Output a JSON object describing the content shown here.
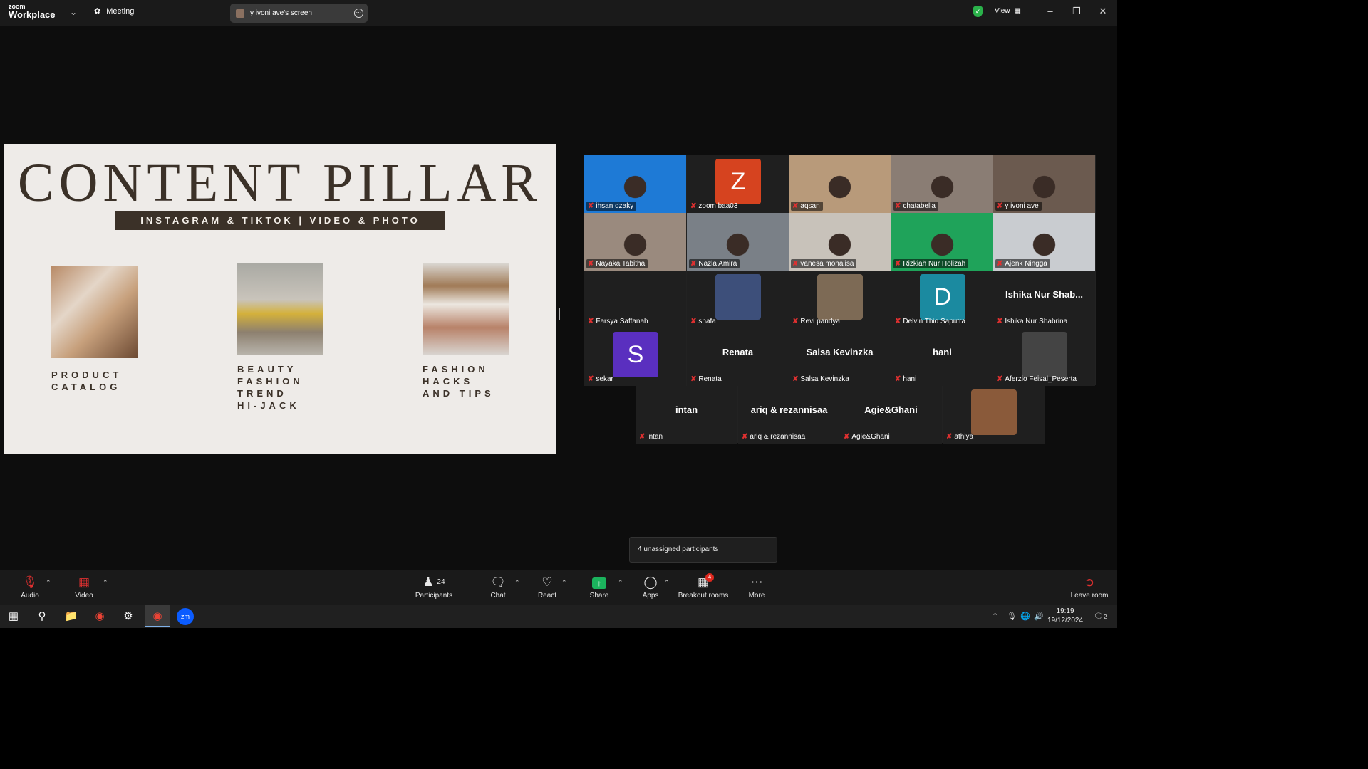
{
  "app": {
    "brand_top": "zoom",
    "brand_name": "Workplace",
    "meeting_label": "Meeting"
  },
  "screen_share": {
    "label": "y ivoni ave's screen"
  },
  "topbar": {
    "view_label": "View"
  },
  "slide": {
    "title": "CONTENT PILLAR",
    "subtitle": "INSTAGRAM & TIKTOK | VIDEO & PHOTO",
    "pillars": [
      {
        "caption": "PRODUCT\nCATALOG"
      },
      {
        "caption": "BEAUTY\nFASHION\nTREND\nHI-JACK"
      },
      {
        "caption": "FASHION\nHACKS\nAND TIPS"
      }
    ]
  },
  "participants": [
    {
      "name": "ihsan dzaky",
      "kind": "video",
      "bg": "#1e7ad6"
    },
    {
      "name": "zoom baa03",
      "kind": "avatar",
      "letter": "Z",
      "bg": "#d6431f"
    },
    {
      "name": "aqsan",
      "kind": "video",
      "bg": "#b89a7a"
    },
    {
      "name": "chatabella",
      "kind": "video",
      "bg": "#8a7d74"
    },
    {
      "name": "y ivoni ave",
      "kind": "video",
      "bg": "#6b5a4f"
    },
    {
      "name": "Nayaka Tabitha",
      "kind": "video",
      "bg": "#9a8a7e"
    },
    {
      "name": "Nazla Amira",
      "kind": "video",
      "bg": "#7a8087"
    },
    {
      "name": "vanesa monalisa",
      "kind": "video",
      "bg": "#c8c2ba",
      "active": true
    },
    {
      "name": "Rizkiah Nur Holizah",
      "kind": "video",
      "bg": "#1fa35a"
    },
    {
      "name": "Ajenk Ningga",
      "kind": "video",
      "bg": "#c9ccd0"
    },
    {
      "name": "Farsya Saffanah",
      "kind": "empty"
    },
    {
      "name": "shafa",
      "kind": "photo",
      "bg": "#3d4f7a"
    },
    {
      "name": "Revi pandya",
      "kind": "photo",
      "bg": "#7d6a55"
    },
    {
      "name": "Delvin Thio Saputra",
      "kind": "avatar",
      "letter": "D",
      "bg": "#1b8aa0"
    },
    {
      "name": "Ishika Nur Shabrina",
      "kind": "text",
      "display": "Ishika Nur Shab..."
    },
    {
      "name": "sekar",
      "kind": "avatar",
      "letter": "S",
      "bg": "#5a2fbf"
    },
    {
      "name": "Renata",
      "kind": "text",
      "display": "Renata"
    },
    {
      "name": "Salsa Kevinzka",
      "kind": "text",
      "display": "Salsa Kevinzka"
    },
    {
      "name": "hani",
      "kind": "text",
      "display": "hani"
    },
    {
      "name": "Aferzio Feisal_Peserta",
      "kind": "photo",
      "bg": "#444"
    },
    {
      "name": "intan",
      "kind": "text",
      "display": "intan"
    },
    {
      "name": "ariq & rezannisaa",
      "kind": "text",
      "display": "ariq & rezannisaa"
    },
    {
      "name": "Agie&Ghani",
      "kind": "text",
      "display": "Agie&Ghani"
    },
    {
      "name": "athiya",
      "kind": "photo",
      "bg": "#8a5a3a"
    }
  ],
  "tooltip": {
    "text": "4 unassigned participants"
  },
  "toolbar": {
    "audio": "Audio",
    "video": "Video",
    "participants": "Participants",
    "participants_count": "24",
    "chat": "Chat",
    "react": "React",
    "share": "Share",
    "apps": "Apps",
    "breakout": "Breakout rooms",
    "breakout_badge": "4",
    "more": "More",
    "leave": "Leave room"
  },
  "taskbar": {
    "time": "19:19",
    "date": "19/12/2024",
    "notifications": "2"
  },
  "colors": {
    "accent_green": "#30d15a",
    "mic_off": "#e03030",
    "slide_bg": "#eeebe8",
    "slide_text": "#3b3128"
  }
}
